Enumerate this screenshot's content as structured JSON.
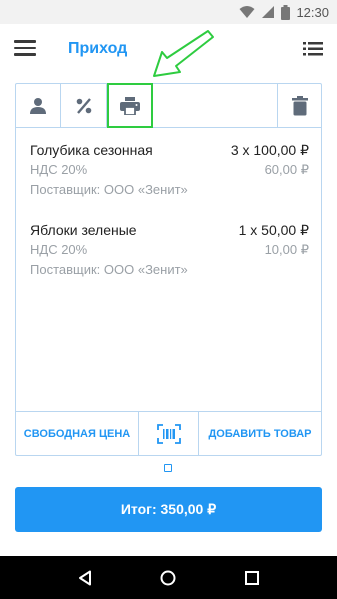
{
  "status_bar": {
    "time": "12:30",
    "icons": [
      "wifi-icon",
      "signal-icon",
      "battery-icon"
    ]
  },
  "app_bar": {
    "title": "Приход",
    "left_icon": "menu-icon",
    "right_icon": "list-icon"
  },
  "toolbar": {
    "buttons": [
      {
        "icon": "person-icon"
      },
      {
        "icon": "percent-icon"
      },
      {
        "icon": "printer-icon"
      },
      {
        "icon": "trash-icon"
      }
    ]
  },
  "items": [
    {
      "name": "Голубика сезонная",
      "qty_price": "3 x 100,00 ₽",
      "vat": "НДС 20%",
      "vat_amount": "60,00 ₽",
      "supplier": "Поставщик: ООО «Зенит»"
    },
    {
      "name": "Яблоки зеленые",
      "qty_price": "1 x 50,00 ₽",
      "vat": "НДС 20%",
      "vat_amount": "10,00 ₽",
      "supplier": "Поставщик: ООО «Зенит»"
    }
  ],
  "bottom_bar": {
    "free_price": "СВОБОДНАЯ ЦЕНА",
    "scan_icon": "barcode-scan-icon",
    "add_product": "ДОБАВИТЬ ТОВАР"
  },
  "total_button": "Итог: 350,00 ₽",
  "colors": {
    "accent": "#2196f3",
    "border": "#b9d6f0",
    "highlight": "#2ecc40",
    "icon_grey": "#5f6b7a",
    "secondary_text": "#9aa0a6"
  },
  "nav_bar": {
    "icons": [
      "back-icon",
      "home-icon",
      "recents-icon"
    ]
  }
}
